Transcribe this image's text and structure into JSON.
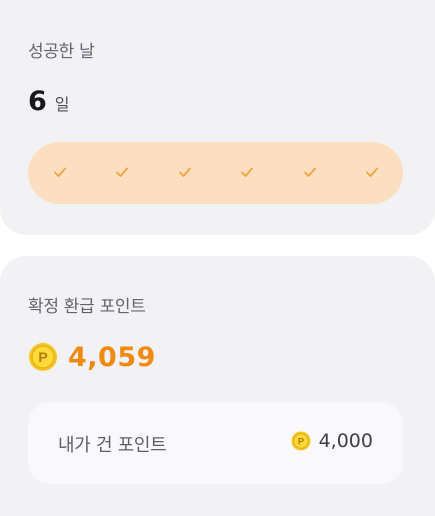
{
  "success_card": {
    "title": "성공한 날",
    "days_count": "6",
    "days_unit": "일",
    "checked_days": 6,
    "accent_color": "#f0a33c",
    "bar_color": "#fbdfc0"
  },
  "points_card": {
    "title": "확정 환급 포인트",
    "points_value": "4,059",
    "points_color": "#f18a12",
    "coin_icon": "point-coin-icon",
    "coin_letter": "P",
    "bet": {
      "label": "내가 건 포인트",
      "value": "4,000"
    }
  }
}
